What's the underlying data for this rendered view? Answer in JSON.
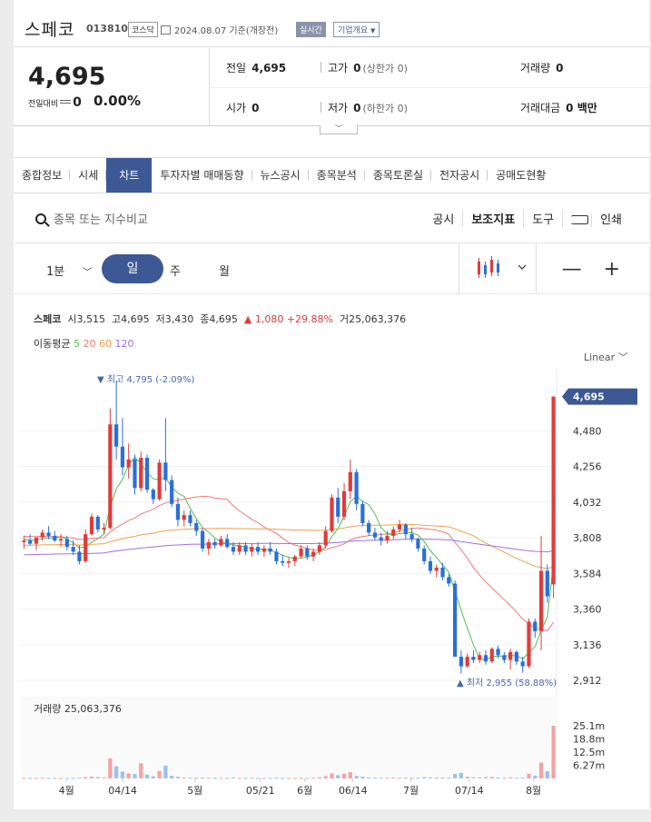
{
  "header": {
    "name": "스페코",
    "code": "013810",
    "market": "코스닥",
    "date": "2024.08.07 기준(개장전)",
    "live": "실시간",
    "company_info": "기업개요"
  },
  "price": {
    "current": "4,695",
    "delta_label": "전일대비",
    "delta_value": "0",
    "delta_pct": "0.00%"
  },
  "stats": {
    "prev_label": "전일",
    "prev": "4,695",
    "high_label": "고가",
    "high": "0",
    "high_limit": "(상한가 0)",
    "volume_label": "거래량",
    "volume": "0",
    "open_label": "시가",
    "open": "0",
    "low_label": "저가",
    "low": "0",
    "low_limit": "(하한가 0)",
    "amount_label": "거래대금",
    "amount": "0 백만"
  },
  "tabs": [
    "종합정보",
    "시세",
    "차트",
    "투자자별 매매동향",
    "뉴스공시",
    "종목분석",
    "종목토론실",
    "전자공시",
    "공매도현황"
  ],
  "toolbar": {
    "search_placeholder": "종목 또는 지수비교",
    "notice": "공시",
    "indicator": "보조지표",
    "tool": "도구",
    "print": "인쇄"
  },
  "period": {
    "minute": "1분",
    "day": "일",
    "week": "주",
    "month": "월"
  },
  "legend": {
    "name": "스페코",
    "open_label": "시",
    "open": "3,515",
    "high_label": "고",
    "high": "4,695",
    "low_label": "저",
    "low": "3,430",
    "close_label": "종",
    "close": "4,695",
    "change": "▲ 1,080 +29.88%",
    "volume_label": "거",
    "volume": "25,063,376",
    "ma_label": "이동평균",
    "ma5": "5",
    "ma20": "20",
    "ma60": "60",
    "ma120": "120",
    "scale": "Linear"
  },
  "chart_data": {
    "type": "candlestick",
    "price_ticks": [
      "4,480",
      "4,256",
      "4,032",
      "3,808",
      "3,584",
      "3,360",
      "3,136",
      "2,912"
    ],
    "current_price_label": "4,695",
    "max_label": "최고 4,795 (-2.09%)",
    "min_label": "최저 2,955 (58.88%)",
    "volume_label": "거래량 25,063,376",
    "volume_ticks": [
      "25.1m",
      "18.8m",
      "12.5m",
      "6.27m"
    ],
    "x_ticks": [
      "4월",
      "04/14",
      "5월",
      "05/21",
      "6월",
      "06/14",
      "7월",
      "07/14",
      "8월"
    ],
    "colors": {
      "up": "#e03b3b",
      "down": "#2a6fd8",
      "ma5": "#4fbf4f",
      "ma20": "#f07a7a",
      "ma60": "#f0a050",
      "ma120": "#a070e0"
    },
    "ohlc": [
      [
        3780,
        3820,
        3740,
        3790
      ],
      [
        3790,
        3830,
        3760,
        3770
      ],
      [
        3770,
        3800,
        3730,
        3810
      ],
      [
        3810,
        3860,
        3790,
        3840
      ],
      [
        3840,
        3880,
        3800,
        3820
      ],
      [
        3820,
        3850,
        3780,
        3790
      ],
      [
        3790,
        3830,
        3750,
        3800
      ],
      [
        3800,
        3820,
        3730,
        3750
      ],
      [
        3750,
        3790,
        3700,
        3720
      ],
      [
        3720,
        3760,
        3640,
        3660
      ],
      [
        3660,
        3860,
        3650,
        3830
      ],
      [
        3830,
        3960,
        3820,
        3940
      ],
      [
        3940,
        3950,
        3840,
        3860
      ],
      [
        3860,
        3900,
        3830,
        3870
      ],
      [
        3870,
        4620,
        3860,
        4520
      ],
      [
        4520,
        4795,
        4300,
        4380
      ],
      [
        4380,
        4560,
        4200,
        4250
      ],
      [
        4250,
        4400,
        4180,
        4300
      ],
      [
        4300,
        4330,
        4080,
        4120
      ],
      [
        4120,
        4350,
        4100,
        4310
      ],
      [
        4310,
        4330,
        4090,
        4110
      ],
      [
        4110,
        4120,
        4020,
        4050
      ],
      [
        4050,
        4300,
        4040,
        4280
      ],
      [
        4280,
        4560,
        4100,
        4170
      ],
      [
        4170,
        4200,
        4000,
        4020
      ],
      [
        4020,
        4060,
        3880,
        3920
      ],
      [
        3920,
        3980,
        3880,
        3950
      ],
      [
        3950,
        3980,
        3880,
        3900
      ],
      [
        3900,
        3920,
        3820,
        3850
      ],
      [
        3850,
        3870,
        3720,
        3740
      ],
      [
        3740,
        3800,
        3700,
        3780
      ],
      [
        3780,
        3800,
        3740,
        3760
      ],
      [
        3760,
        3820,
        3750,
        3800
      ],
      [
        3800,
        3830,
        3740,
        3750
      ],
      [
        3750,
        3780,
        3700,
        3720
      ],
      [
        3720,
        3780,
        3700,
        3760
      ],
      [
        3760,
        3780,
        3700,
        3720
      ],
      [
        3720,
        3770,
        3690,
        3750
      ],
      [
        3750,
        3780,
        3700,
        3720
      ],
      [
        3720,
        3760,
        3690,
        3740
      ],
      [
        3740,
        3780,
        3700,
        3720
      ],
      [
        3720,
        3740,
        3640,
        3660
      ],
      [
        3660,
        3700,
        3630,
        3650
      ],
      [
        3650,
        3680,
        3620,
        3660
      ],
      [
        3660,
        3700,
        3630,
        3690
      ],
      [
        3690,
        3760,
        3680,
        3740
      ],
      [
        3740,
        3760,
        3670,
        3690
      ],
      [
        3690,
        3740,
        3660,
        3720
      ],
      [
        3720,
        3780,
        3700,
        3760
      ],
      [
        3760,
        3880,
        3740,
        3850
      ],
      [
        3850,
        4080,
        3840,
        4060
      ],
      [
        4060,
        4120,
        3900,
        3940
      ],
      [
        3940,
        4150,
        3920,
        4100
      ],
      [
        4100,
        4300,
        4050,
        4220
      ],
      [
        4220,
        4240,
        3980,
        4020
      ],
      [
        4020,
        4040,
        3880,
        3900
      ],
      [
        3900,
        3920,
        3820,
        3840
      ],
      [
        3840,
        3870,
        3790,
        3810
      ],
      [
        3810,
        3840,
        3760,
        3790
      ],
      [
        3790,
        3850,
        3770,
        3820
      ],
      [
        3820,
        3880,
        3800,
        3860
      ],
      [
        3860,
        3920,
        3840,
        3890
      ],
      [
        3890,
        3900,
        3800,
        3830
      ],
      [
        3830,
        3870,
        3780,
        3800
      ],
      [
        3800,
        3810,
        3720,
        3740
      ],
      [
        3740,
        3760,
        3640,
        3660
      ],
      [
        3660,
        3690,
        3580,
        3600
      ],
      [
        3600,
        3640,
        3560,
        3620
      ],
      [
        3620,
        3650,
        3540,
        3560
      ],
      [
        3560,
        3580,
        3500,
        3520
      ],
      [
        3520,
        3540,
        3250,
        3060
      ],
      [
        3060,
        3100,
        2955,
        3000
      ],
      [
        3000,
        3080,
        2990,
        3060
      ],
      [
        3060,
        3100,
        3020,
        3040
      ],
      [
        3040,
        3090,
        3020,
        3070
      ],
      [
        3070,
        3100,
        3010,
        3030
      ],
      [
        3030,
        3120,
        3020,
        3110
      ],
      [
        3110,
        3130,
        3050,
        3070
      ],
      [
        3070,
        3090,
        3020,
        3040
      ],
      [
        3040,
        3110,
        2980,
        3090
      ],
      [
        3090,
        3100,
        3010,
        3030
      ],
      [
        3030,
        3060,
        2960,
        3000
      ],
      [
        3000,
        3300,
        2990,
        3280
      ],
      [
        3280,
        3300,
        3180,
        3220
      ],
      [
        3220,
        3820,
        3100,
        3600
      ],
      [
        3600,
        3640,
        3400,
        3440
      ],
      [
        3515,
        4695,
        3430,
        4695
      ]
    ],
    "volume": [
      0.2,
      0.2,
      0.2,
      0.3,
      0.2,
      0.2,
      0.1,
      0.2,
      0.2,
      0.3,
      0.6,
      0.8,
      0.6,
      0.5,
      9.5,
      5.8,
      3.2,
      2.4,
      2.1,
      7.2,
      1.8,
      1.0,
      3.5,
      6.1,
      1.2,
      0.8,
      0.4,
      0.3,
      0.3,
      0.4,
      0.3,
      0.2,
      0.2,
      0.2,
      0.3,
      0.2,
      0.2,
      0.3,
      0.2,
      0.2,
      0.2,
      0.3,
      0.2,
      0.2,
      0.2,
      0.3,
      0.2,
      0.3,
      0.6,
      1.1,
      2.4,
      1.5,
      2.2,
      3.0,
      1.2,
      0.8,
      0.5,
      0.4,
      0.3,
      0.3,
      0.4,
      0.3,
      0.3,
      0.3,
      0.4,
      0.6,
      0.5,
      0.3,
      0.4,
      0.3,
      2.1,
      2.6,
      0.7,
      0.5,
      0.4,
      0.6,
      0.7,
      0.4,
      0.3,
      0.5,
      0.3,
      0.4,
      2.2,
      1.3,
      7.6,
      3.4,
      25.1
    ]
  }
}
